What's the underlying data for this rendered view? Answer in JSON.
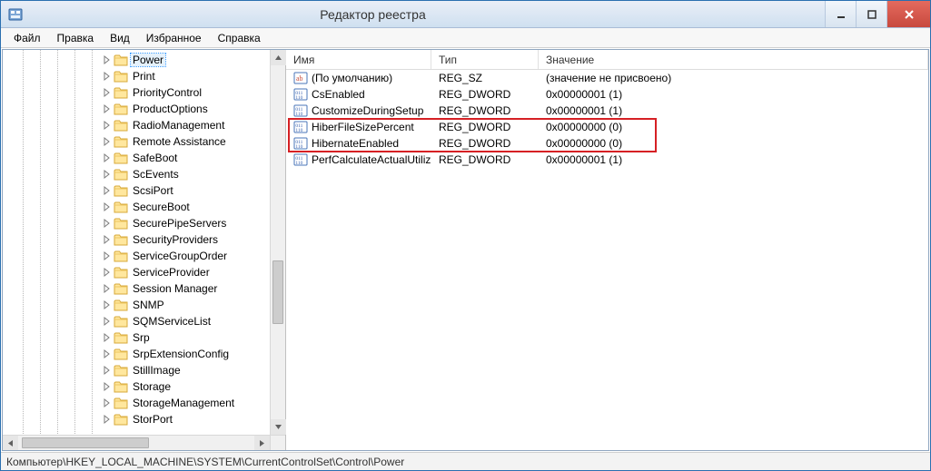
{
  "window": {
    "title": "Редактор реестра"
  },
  "menu": {
    "file": "Файл",
    "edit": "Правка",
    "view": "Вид",
    "favorites": "Избранное",
    "help": "Справка"
  },
  "tree": {
    "selected": "Power",
    "items": [
      {
        "label": "Power",
        "selected": true
      },
      {
        "label": "Print"
      },
      {
        "label": "PriorityControl"
      },
      {
        "label": "ProductOptions"
      },
      {
        "label": "RadioManagement"
      },
      {
        "label": "Remote Assistance"
      },
      {
        "label": "SafeBoot"
      },
      {
        "label": "ScEvents"
      },
      {
        "label": "ScsiPort"
      },
      {
        "label": "SecureBoot"
      },
      {
        "label": "SecurePipeServers"
      },
      {
        "label": "SecurityProviders"
      },
      {
        "label": "ServiceGroupOrder"
      },
      {
        "label": "ServiceProvider"
      },
      {
        "label": "Session Manager"
      },
      {
        "label": "SNMP"
      },
      {
        "label": "SQMServiceList"
      },
      {
        "label": "Srp"
      },
      {
        "label": "SrpExtensionConfig"
      },
      {
        "label": "StillImage"
      },
      {
        "label": "Storage"
      },
      {
        "label": "StorageManagement"
      },
      {
        "label": "StorPort"
      }
    ]
  },
  "list": {
    "headers": {
      "name": "Имя",
      "type": "Тип",
      "value": "Значение"
    },
    "rows": [
      {
        "icon": "sz",
        "name": "(По умолчанию)",
        "type": "REG_SZ",
        "value": "(значение не присвоено)",
        "hi": false
      },
      {
        "icon": "dw",
        "name": "CsEnabled",
        "type": "REG_DWORD",
        "value": "0x00000001 (1)",
        "hi": false
      },
      {
        "icon": "dw",
        "name": "CustomizeDuringSetup",
        "type": "REG_DWORD",
        "value": "0x00000001 (1)",
        "hi": false
      },
      {
        "icon": "dw",
        "name": "HiberFileSizePercent",
        "type": "REG_DWORD",
        "value": "0x00000000 (0)",
        "hi": true
      },
      {
        "icon": "dw",
        "name": "HibernateEnabled",
        "type": "REG_DWORD",
        "value": "0x00000000 (0)",
        "hi": true
      },
      {
        "icon": "dw",
        "name": "PerfCalculateActualUtiliz...",
        "type": "REG_DWORD",
        "value": "0x00000001 (1)",
        "hi": false
      }
    ]
  },
  "statusbar": {
    "path": "Компьютер\\HKEY_LOCAL_MACHINE\\SYSTEM\\CurrentControlSet\\Control\\Power"
  },
  "icons": {
    "app": "regedit-icon",
    "minimize": "minimize-icon",
    "maximize": "maximize-icon",
    "close": "close-icon",
    "folder": "folder-icon",
    "expander": "expander-icon",
    "sz": "reg-sz-icon",
    "dw": "reg-dword-icon"
  }
}
